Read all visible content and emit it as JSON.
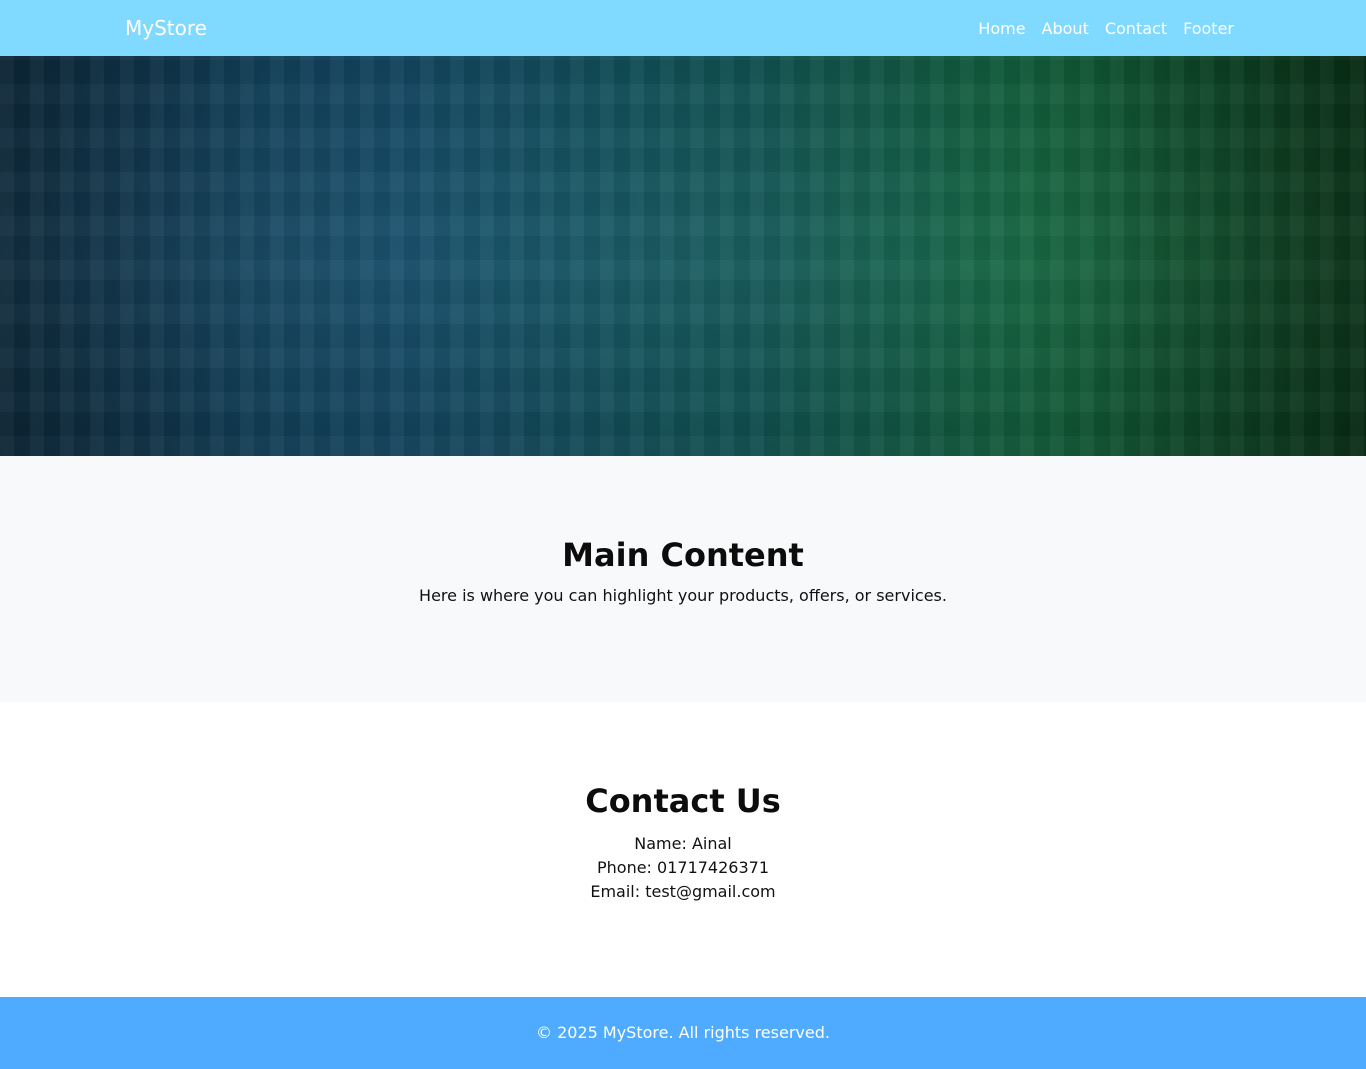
{
  "navbar": {
    "brand": "MyStore",
    "links": [
      "Home",
      "About",
      "Contact",
      "Footer"
    ]
  },
  "main": {
    "title": "Main Content",
    "text": "Here is where you can highlight your products, offers, or services."
  },
  "contact": {
    "title": "Contact Us",
    "name": "Name: Ainal",
    "phone": "Phone: 01717426371",
    "email": "Email: test@gmail.com"
  },
  "footer": {
    "text": "© 2025 MyStore. All rights reserved."
  },
  "colors": {
    "navbar_bg": "#80d9ff",
    "footer_bg": "#4eabff",
    "main_bg": "#f8f9fa"
  }
}
